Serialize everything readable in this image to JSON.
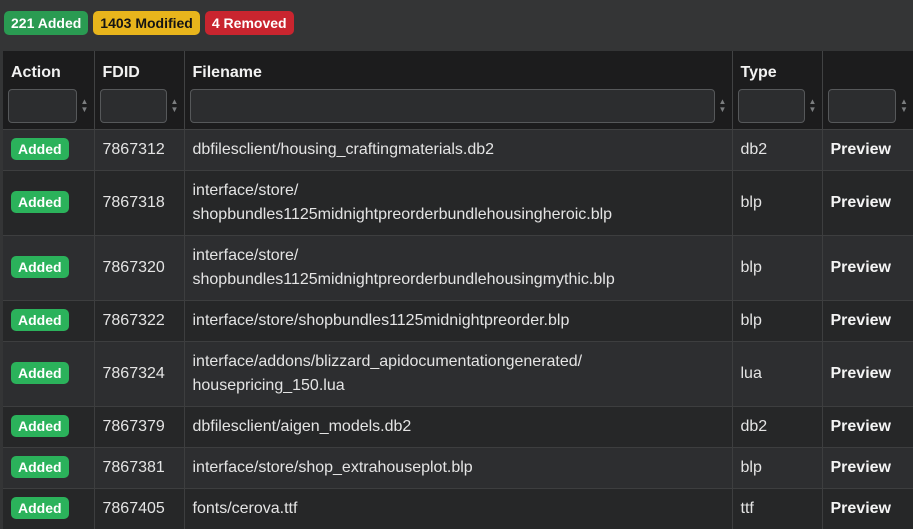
{
  "summary": {
    "added": "221 Added",
    "modified": "1403 Modified",
    "removed": "4 Removed"
  },
  "columns": {
    "action": "Action",
    "fdid": "FDID",
    "filename": "Filename",
    "type": "Type",
    "preview": ""
  },
  "rows": [
    {
      "action": "Added",
      "fdid": "7867312",
      "filename": "dbfilesclient/housing_craftingmaterials.db2",
      "type": "db2",
      "preview": "Preview"
    },
    {
      "action": "Added",
      "fdid": "7867318",
      "filename": "interface/store/\nshopbundles1125midnightpreorderbundlehousingheroic.blp",
      "type": "blp",
      "preview": "Preview"
    },
    {
      "action": "Added",
      "fdid": "7867320",
      "filename": "interface/store/\nshopbundles1125midnightpreorderbundlehousingmythic.blp",
      "type": "blp",
      "preview": "Preview"
    },
    {
      "action": "Added",
      "fdid": "7867322",
      "filename": "interface/store/shopbundles1125midnightpreorder.blp",
      "type": "blp",
      "preview": "Preview"
    },
    {
      "action": "Added",
      "fdid": "7867324",
      "filename": "interface/addons/blizzard_apidocumentationgenerated/\nhousepricing_150.lua",
      "type": "lua",
      "preview": "Preview"
    },
    {
      "action": "Added",
      "fdid": "7867379",
      "filename": "dbfilesclient/aigen_models.db2",
      "type": "db2",
      "preview": "Preview"
    },
    {
      "action": "Added",
      "fdid": "7867381",
      "filename": "interface/store/shop_extrahouseplot.blp",
      "type": "blp",
      "preview": "Preview"
    },
    {
      "action": "Added",
      "fdid": "7867405",
      "filename": "fonts/cerova.ttf",
      "type": "ttf",
      "preview": "Preview"
    }
  ]
}
